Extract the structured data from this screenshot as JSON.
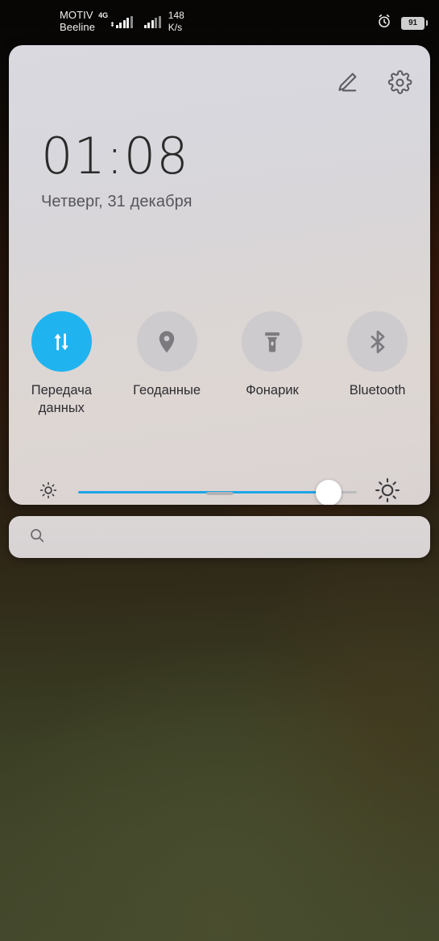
{
  "statusbar": {
    "sim1": {
      "carrier": "MOTIV",
      "network_type": "4G",
      "signal_bars": 4,
      "roaming_glyph": "⬍"
    },
    "sim2": {
      "carrier": "Beeline",
      "signal_bars": 3
    },
    "network_speed": {
      "value": "148",
      "unit": "K/s"
    },
    "alarm_icon": "alarm-clock-icon",
    "battery": {
      "level": "91",
      "icon": "battery-icon"
    }
  },
  "quick_settings": {
    "edit_button": {
      "name": "edit-pencil-icon",
      "label": "Изменить"
    },
    "settings_button": {
      "name": "gear-icon",
      "label": "Настройки"
    },
    "clock": {
      "time": "01:08",
      "date": "Четверг, 31 декабря"
    },
    "toggles": [
      {
        "label": "Передача данных",
        "icon": "mobile-data-icon",
        "state": "on",
        "accent": "#1fb4ef"
      },
      {
        "label": "Геоданные",
        "icon": "location-pin-icon",
        "state": "off",
        "accent": "#cdcbcd"
      },
      {
        "label": "Фонарик",
        "icon": "flashlight-icon",
        "state": "off",
        "accent": "#cdcbcd"
      },
      {
        "label": "Bluetooth",
        "icon": "bluetooth-icon",
        "state": "off",
        "accent": "#cdcbcd"
      }
    ],
    "brightness": {
      "value_percent": 90,
      "low_icon": "brightness-low-sun-icon",
      "high_icon": "brightness-high-sun-icon",
      "fill_color": "#1fa6e4"
    },
    "drag_handle": "panel-drag-handle"
  },
  "search": {
    "icon": "search-icon",
    "value": "",
    "placeholder": ""
  }
}
